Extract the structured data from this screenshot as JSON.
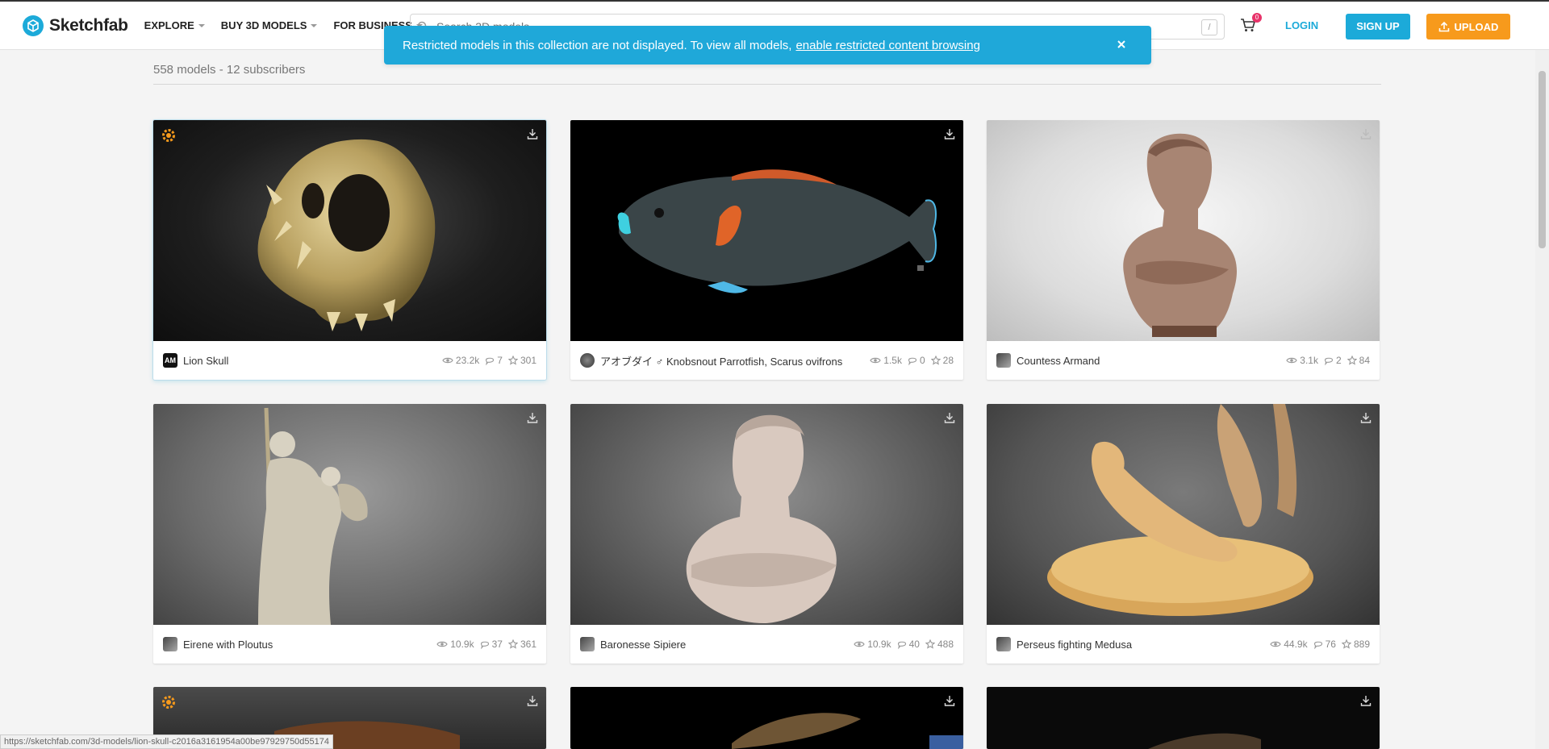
{
  "header": {
    "logo_text": "Sketchfab",
    "nav": [
      {
        "label": "EXPLORE"
      },
      {
        "label": "BUY 3D MODELS"
      },
      {
        "label": "FOR BUSINESS"
      }
    ],
    "search_placeholder": "Search 3D models",
    "search_key_hint": "/",
    "cart_badge": "0",
    "login_label": "LOGIN",
    "signup_label": "SIGN UP",
    "upload_label": "UPLOAD"
  },
  "notice": {
    "text": "Restricted models in this collection are not displayed. To view all models,",
    "link": "enable restricted content browsing"
  },
  "collection": {
    "stats": "558 models - 12 subscribers"
  },
  "models": [
    {
      "name": "Lion Skull",
      "views": "23.2k",
      "comments": "7",
      "likes": "301",
      "avatar": "AM"
    },
    {
      "name": "アオブダイ ♂ Knobsnout Parrotfish, Scarus ovifrons",
      "views": "1.5k",
      "comments": "0",
      "likes": "28"
    },
    {
      "name": "Countess Armand",
      "views": "3.1k",
      "comments": "2",
      "likes": "84"
    },
    {
      "name": "Eirene with Ploutus",
      "views": "10.9k",
      "comments": "37",
      "likes": "361"
    },
    {
      "name": "Baronesse Sipiere",
      "views": "10.9k",
      "comments": "40",
      "likes": "488"
    },
    {
      "name": "Perseus fighting Medusa",
      "views": "44.9k",
      "comments": "76",
      "likes": "889"
    }
  ],
  "statusbar": {
    "url": "https://sketchfab.com/3d-models/lion-skull-c2016a3161954a00be97929750d55174"
  },
  "colors": {
    "brand_blue": "#1caad9",
    "upload_orange": "#f79a1c",
    "notice_bg": "#1fa8d9"
  }
}
